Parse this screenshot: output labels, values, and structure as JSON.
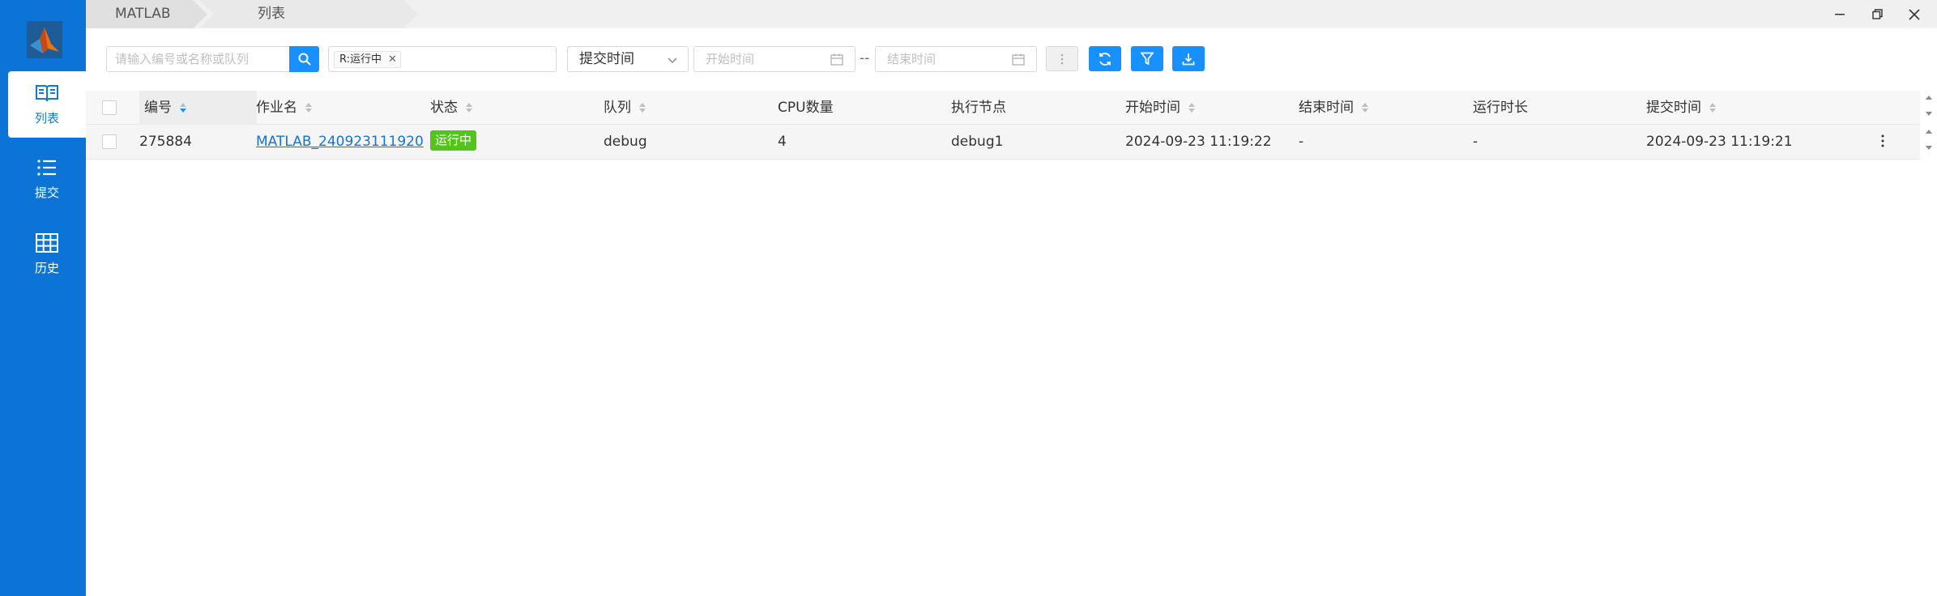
{
  "breadcrumbs": [
    "MATLAB",
    "列表"
  ],
  "sidebar": {
    "items": [
      {
        "label": "列表",
        "icon": "book-icon",
        "active": true
      },
      {
        "label": "提交",
        "icon": "list-icon",
        "active": false
      },
      {
        "label": "历史",
        "icon": "grid-icon",
        "active": false
      }
    ]
  },
  "toolbar": {
    "search_placeholder": "请输入编号或名称或队列",
    "filter_tag": "R:运行中",
    "sort_select": "提交时间",
    "start_placeholder": "开始时间",
    "range_separator": "--",
    "end_placeholder": "结束时间"
  },
  "table": {
    "headers": [
      "编号",
      "作业名",
      "状态",
      "队列",
      "CPU数量",
      "执行节点",
      "开始时间",
      "结束时间",
      "运行时长",
      "提交时间"
    ],
    "rows": [
      {
        "id": "275884",
        "name": "MATLAB_240923111920",
        "status": "运行中",
        "queue": "debug",
        "cpu": "4",
        "node": "debug1",
        "start": "2024-09-23 11:19:22",
        "end": "-",
        "duration": "-",
        "submit": "2024-09-23 11:19:21"
      }
    ]
  },
  "colors": {
    "sidebar": "#0d74d7",
    "primary": "#1890ff",
    "status_running": "#52c41a"
  }
}
